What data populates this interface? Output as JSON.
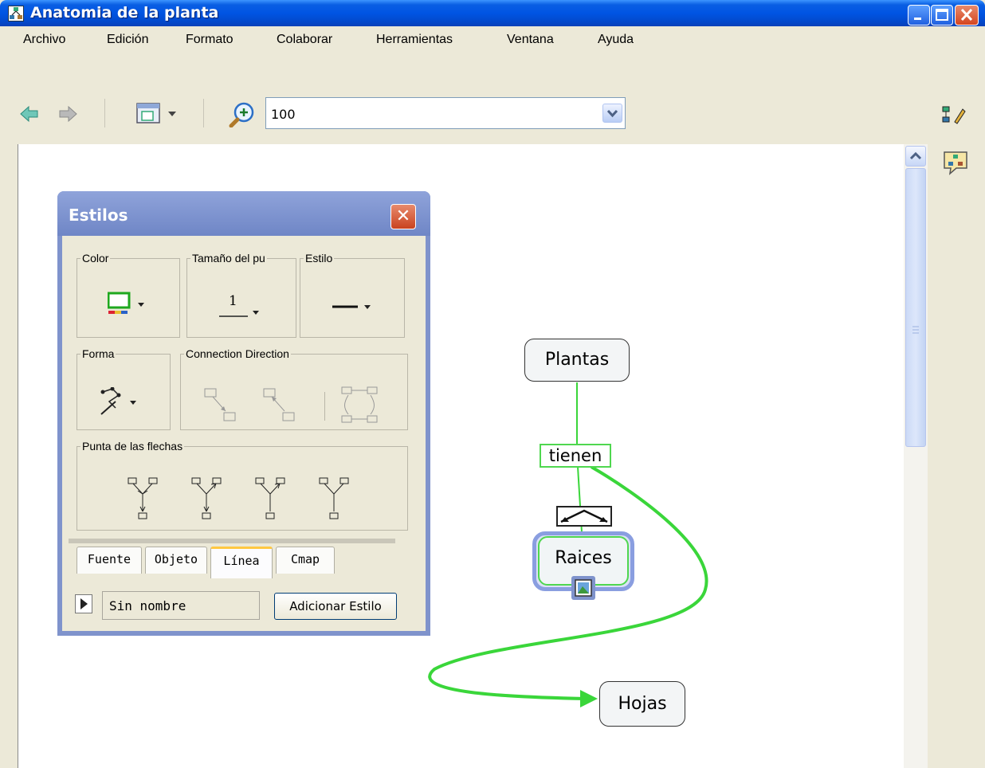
{
  "window": {
    "title": "Anatomia de la planta"
  },
  "menu": [
    "Archivo",
    "Edición",
    "Formato",
    "Colaborar",
    "Herramientas",
    "Ventana",
    "Ayuda"
  ],
  "toolbar": {
    "zoom_value": "100"
  },
  "styles_panel": {
    "title": "Estilos",
    "close_glyph": "✕",
    "groups": {
      "color": "Color",
      "size": "Tamaño del pu",
      "style": "Estilo",
      "shape": "Forma",
      "direction": "Connection Direction",
      "arrowheads": "Punta de las flechas"
    },
    "size_value": "1",
    "tabs": [
      "Fuente",
      "Objeto",
      "Línea",
      "Cmap"
    ],
    "active_tab": "Línea",
    "style_name": "Sin nombre",
    "add_style_label": "Adicionar Estilo"
  },
  "map": {
    "concepts": [
      "Plantas",
      "Raices",
      "Hojas"
    ],
    "link_label": "tienen"
  },
  "colors": {
    "titlebar": "#0054e3",
    "link_green": "#3ad63a",
    "selection_blue": "#8a9ee0",
    "panel_frame": "#7f93cc"
  },
  "icons": [
    "back-arrow-icon",
    "forward-arrow-icon",
    "view-menu-icon",
    "zoom-icon",
    "scroll-up-icon",
    "cmap-properties-icon",
    "collaboration-icon",
    "image-resource-icon"
  ]
}
